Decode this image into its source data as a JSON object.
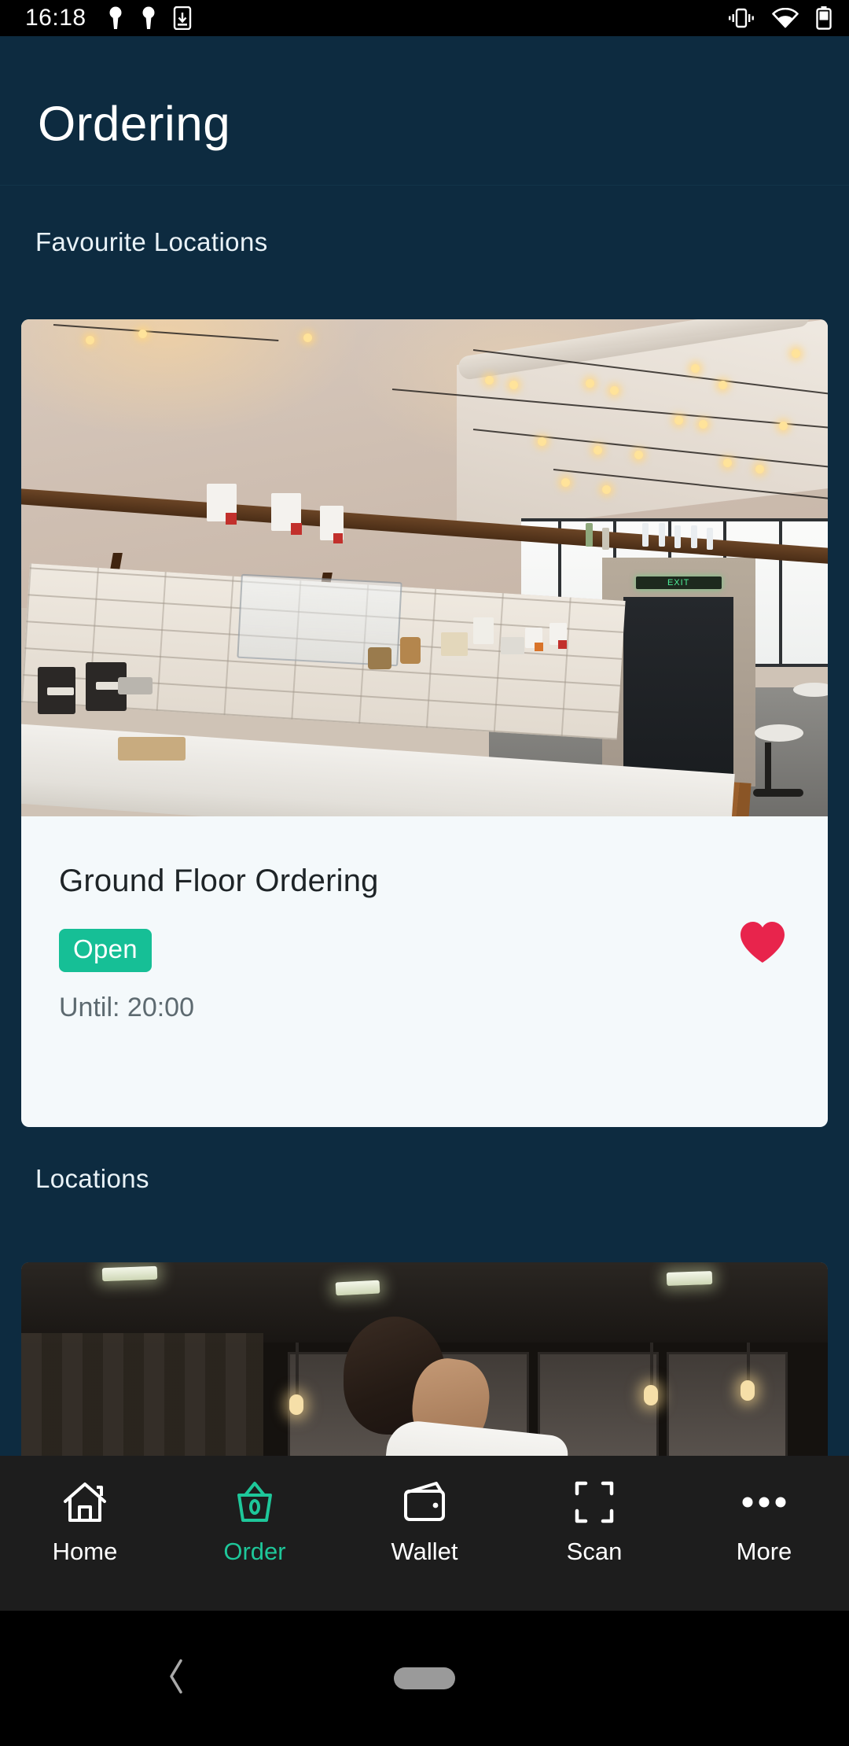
{
  "status_bar": {
    "time": "16:18",
    "left_icons": [
      "key-icon",
      "key-icon",
      "app-download-icon"
    ],
    "right_icons": [
      "vibrate-icon",
      "wifi-icon",
      "battery-icon"
    ],
    "background": "#000000"
  },
  "app_bar": {
    "title": "Ordering",
    "background": "#0d2b40"
  },
  "sections": [
    {
      "title": "Favourite Locations"
    },
    {
      "title": "Locations"
    }
  ],
  "favourite_card": {
    "title": "Ground Floor Ordering",
    "status_badge": "Open",
    "status_color": "#16bf96",
    "until_text": "Until: 20:00",
    "favourite_icon": "heart-filled-icon",
    "favourite_color": "#e8244c",
    "image_alt": "cafe-interior-photo"
  },
  "locations_card": {
    "image_alt": "bar-interior-photo"
  },
  "tab_bar": {
    "background": "#1d1d1d",
    "active_color": "#1ec79a",
    "items": [
      {
        "label": "Home",
        "icon": "home-icon",
        "active": false
      },
      {
        "label": "Order",
        "icon": "cup-icon",
        "active": true
      },
      {
        "label": "Wallet",
        "icon": "wallet-icon",
        "active": false
      },
      {
        "label": "Scan",
        "icon": "scan-icon",
        "active": false
      },
      {
        "label": "More",
        "icon": "more-dots-icon",
        "active": false
      }
    ]
  },
  "system_nav": {
    "back_icon": "chevron-left-icon",
    "home_pill": "home-pill-indicator"
  }
}
